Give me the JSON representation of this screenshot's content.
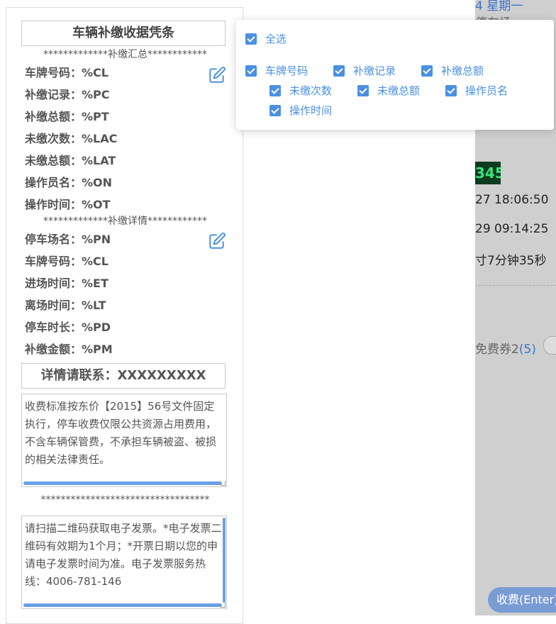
{
  "background": {
    "date_fragment": "4 星期一",
    "status_fragment": "停车场",
    "plate_fragment": "345",
    "time1": "27 18:06:50",
    "time2": "29 09:14:25",
    "duration": "寸7分钟35秒",
    "coupon_label": "免费券2",
    "coupon_count": "(5)",
    "charge_button": "收费(Enter)"
  },
  "receipt": {
    "title": "车辆补缴收据凭条",
    "summary_separator": "*************补缴汇总************",
    "summary_fields": [
      {
        "label": "车牌号码：",
        "value": "%CL"
      },
      {
        "label": "补缴记录：",
        "value": "%PC"
      },
      {
        "label": "补缴总额：",
        "value": "%PT"
      },
      {
        "label": "未缴次数：",
        "value": "%LAC"
      },
      {
        "label": "未缴总额：",
        "value": "%LAT"
      },
      {
        "label": "操作员名：",
        "value": "%ON"
      },
      {
        "label": "操作时间：",
        "value": "%OT"
      }
    ],
    "detail_separator": "*************补缴详情************",
    "detail_fields": [
      {
        "label": "停车场名：",
        "value": "%PN"
      },
      {
        "label": "车牌号码：",
        "value": "%CL"
      },
      {
        "label": "进场时间：",
        "value": "%ET"
      },
      {
        "label": "离场时间：",
        "value": "%LT"
      },
      {
        "label": "停车时长：",
        "value": "%PD"
      },
      {
        "label": "补缴金额：",
        "value": "%PM"
      }
    ],
    "contact": "详情请联系：XXXXXXXXX",
    "notice_text": "收费标准按东价【2015】56号文件固定执行，停车收费仅限公共资源占用费用，不含车辆保管费，不承担车辆被盗、被损的相关法律责任。",
    "bottom_separator": "**********************************",
    "invoice_text": "请扫描二维码获取电子发票。*电子发票二维码有效期为1个月；*开票日期以您的申请电子发票时间为准。电子发票服务热线：4006-781-146"
  },
  "popup": {
    "select_all": "全选",
    "options": [
      "车牌号码",
      "补缴记录",
      "补缴总额",
      "未缴次数",
      "未缴总额",
      "操作员名",
      "操作时间"
    ]
  },
  "colors": {
    "accent": "#4a90e2",
    "scrollbar": "#6aa0e6"
  },
  "icons": {
    "edit": "edit-icon",
    "checkbox": "checkbox-checked-icon"
  }
}
